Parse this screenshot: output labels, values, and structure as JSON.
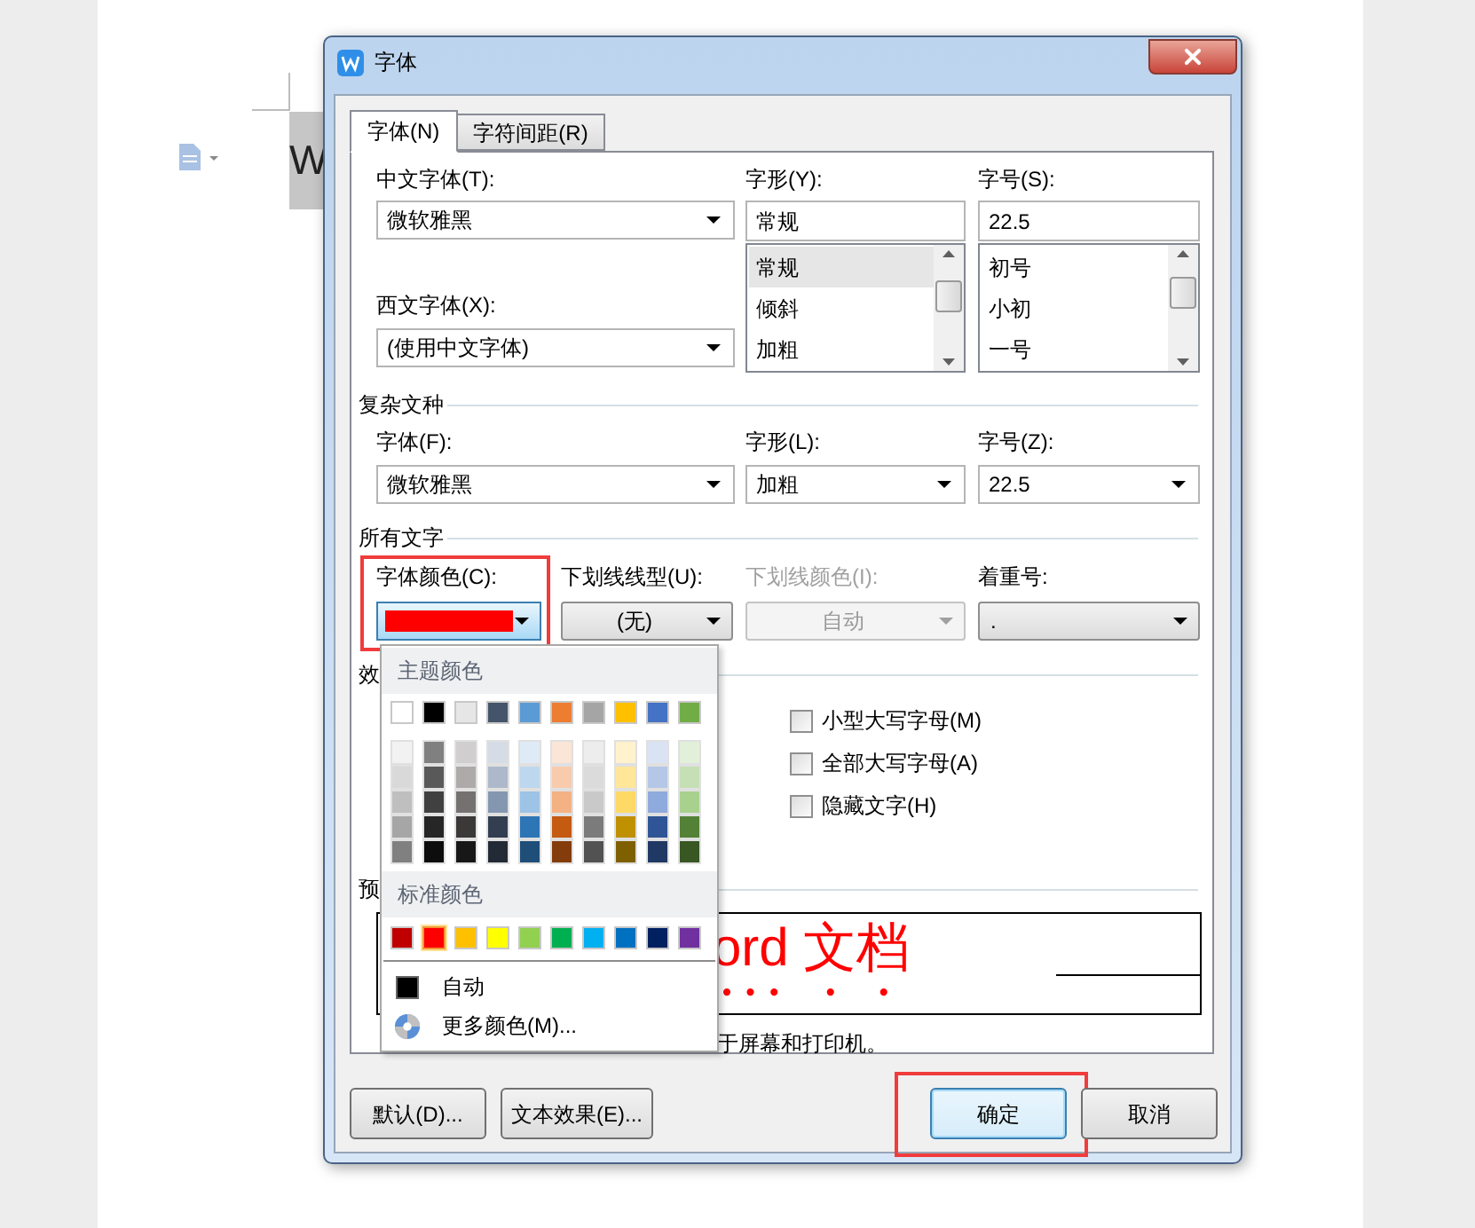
{
  "background": {
    "document_text": "W"
  },
  "dialog": {
    "title": "字体",
    "tabs": [
      {
        "label": "字体(N)",
        "selected": true
      },
      {
        "label": "字符间距(R)",
        "selected": false
      }
    ],
    "chinese_font": {
      "label": "中文字体(T):",
      "value": "微软雅黑"
    },
    "western_font": {
      "label": "西文字体(X):",
      "value": "(使用中文字体)"
    },
    "style": {
      "label": "字形(Y):",
      "value": "常规",
      "options": [
        {
          "text": "常规",
          "selected": true
        },
        {
          "text": "倾斜",
          "selected": false
        },
        {
          "text": "加粗",
          "selected": false
        }
      ]
    },
    "size": {
      "label": "字号(S):",
      "value": "22.5",
      "options": [
        {
          "text": "初号",
          "selected": false
        },
        {
          "text": "小初",
          "selected": false
        },
        {
          "text": "一号",
          "selected": false
        }
      ]
    },
    "complex_script": {
      "heading": "复杂文种",
      "fields": [
        {
          "label": "字体(F):",
          "value": "微软雅黑"
        },
        {
          "label": "字形(L):",
          "value": "加粗"
        },
        {
          "label": "字号(Z):",
          "value": "22.5"
        }
      ]
    },
    "all_text": {
      "heading": "所有文字",
      "font_color": {
        "label": "字体颜色(C):",
        "color": "#ff0000",
        "highlighted": true
      },
      "fields": [
        {
          "label": "下划线线型(U):",
          "value": "(无)",
          "disabled": false,
          "kind": "centered"
        },
        {
          "label": "下划线颜色(I):",
          "value": "自动",
          "disabled": true,
          "kind": "centered"
        },
        {
          "label": "着重号:",
          "value": ".",
          "disabled": false,
          "kind": "left"
        }
      ]
    },
    "effects": {
      "heading": "效",
      "options": [
        {
          "label": "小型大写字母(M)",
          "checked": false
        },
        {
          "label": "全部大写字母(A)",
          "checked": false
        },
        {
          "label": "隐藏文字(H)",
          "checked": false
        }
      ]
    },
    "preview": {
      "heading": "预",
      "sample": "ord 文档"
    },
    "note": "于屏幕和打印机。",
    "buttons": [
      {
        "label": "默认(D)...",
        "kind": "left",
        "highlighted": false
      },
      {
        "label": "文本效果(E)...",
        "kind": "left",
        "highlighted": false
      },
      {
        "label": "确定",
        "kind": "default",
        "highlighted": true
      },
      {
        "label": "取消",
        "kind": "normal",
        "highlighted": false
      }
    ],
    "color_popup": {
      "theme_heading": "主题颜色",
      "theme_colors": [
        {
          "color": "#ffffff",
          "shades": [
            {
              "color": "#f2f2f2"
            },
            {
              "color": "#d9d9d9"
            },
            {
              "color": "#bfbfbf"
            },
            {
              "color": "#a6a6a6"
            },
            {
              "color": "#808080"
            }
          ]
        },
        {
          "color": "#000000",
          "shades": [
            {
              "color": "#808080"
            },
            {
              "color": "#595959"
            },
            {
              "color": "#404040"
            },
            {
              "color": "#262626"
            },
            {
              "color": "#0d0d0d"
            }
          ]
        },
        {
          "color": "#e7e6e6",
          "shades": [
            {
              "color": "#d0cece"
            },
            {
              "color": "#aeaaaa"
            },
            {
              "color": "#767171"
            },
            {
              "color": "#3b3838"
            },
            {
              "color": "#181717"
            }
          ]
        },
        {
          "color": "#44546a",
          "shades": [
            {
              "color": "#d6dce5"
            },
            {
              "color": "#adb9ca"
            },
            {
              "color": "#8497b0"
            },
            {
              "color": "#333f50"
            },
            {
              "color": "#222a35"
            }
          ]
        },
        {
          "color": "#5b9bd5",
          "shades": [
            {
              "color": "#deebf7"
            },
            {
              "color": "#bdd7ee"
            },
            {
              "color": "#9dc3e6"
            },
            {
              "color": "#2e75b6"
            },
            {
              "color": "#1f4e79"
            }
          ]
        },
        {
          "color": "#ed7d31",
          "shades": [
            {
              "color": "#fbe5d6"
            },
            {
              "color": "#f8cbad"
            },
            {
              "color": "#f4b183"
            },
            {
              "color": "#c55a11"
            },
            {
              "color": "#843c0c"
            }
          ]
        },
        {
          "color": "#a5a5a5",
          "shades": [
            {
              "color": "#ededed"
            },
            {
              "color": "#dbdbdb"
            },
            {
              "color": "#c9c9c9"
            },
            {
              "color": "#7b7b7b"
            },
            {
              "color": "#525252"
            }
          ]
        },
        {
          "color": "#ffc000",
          "shades": [
            {
              "color": "#fff2cc"
            },
            {
              "color": "#ffe699"
            },
            {
              "color": "#ffd966"
            },
            {
              "color": "#bf9000"
            },
            {
              "color": "#7f6000"
            }
          ]
        },
        {
          "color": "#4472c4",
          "shades": [
            {
              "color": "#dae3f3"
            },
            {
              "color": "#b4c7e7"
            },
            {
              "color": "#8faadc"
            },
            {
              "color": "#2f5597"
            },
            {
              "color": "#203864"
            }
          ]
        },
        {
          "color": "#70ad47",
          "shades": [
            {
              "color": "#e2f0d9"
            },
            {
              "color": "#c5e0b4"
            },
            {
              "color": "#a9d18e"
            },
            {
              "color": "#538135"
            },
            {
              "color": "#385723"
            }
          ]
        }
      ],
      "standard_heading": "标准颜色",
      "standard_colors": [
        {
          "color": "#c00000",
          "selected": false
        },
        {
          "color": "#ff0000",
          "selected": true
        },
        {
          "color": "#ffc000",
          "selected": false
        },
        {
          "color": "#ffff00",
          "selected": false
        },
        {
          "color": "#92d050",
          "selected": false
        },
        {
          "color": "#00b050",
          "selected": false
        },
        {
          "color": "#00b0f0",
          "selected": false
        },
        {
          "color": "#0070c0",
          "selected": false
        },
        {
          "color": "#002060",
          "selected": false
        },
        {
          "color": "#7030a0",
          "selected": false
        }
      ],
      "auto_label": "自动",
      "more_label": "更多颜色(M)..."
    }
  }
}
